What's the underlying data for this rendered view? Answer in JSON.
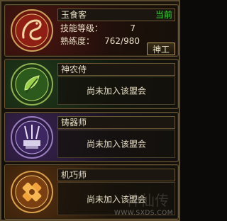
{
  "cards": [
    {
      "title": "玉食客",
      "badge": "当前",
      "skill_label": "技能等级：",
      "skill_value": "7",
      "proficiency_label": "熟练度：",
      "proficiency_value": "762/980",
      "button_label": "神工"
    },
    {
      "title": "神农侍",
      "message": "尚未加入该盟会"
    },
    {
      "title": "铸器师",
      "message": "尚未加入该盟会"
    },
    {
      "title": "机巧师",
      "message": "尚未加入该盟会"
    }
  ],
  "watermark": {
    "glyphs": "神仙传",
    "url": "WWW.SXDS.COM"
  },
  "colors": {
    "badge": "#2fe02f",
    "text": "#e8dfc5",
    "border": "#6b5634"
  },
  "icons": [
    "dragon-emblem-icon",
    "leaf-emblem-icon",
    "forge-emblem-icon",
    "gear-emblem-icon"
  ]
}
